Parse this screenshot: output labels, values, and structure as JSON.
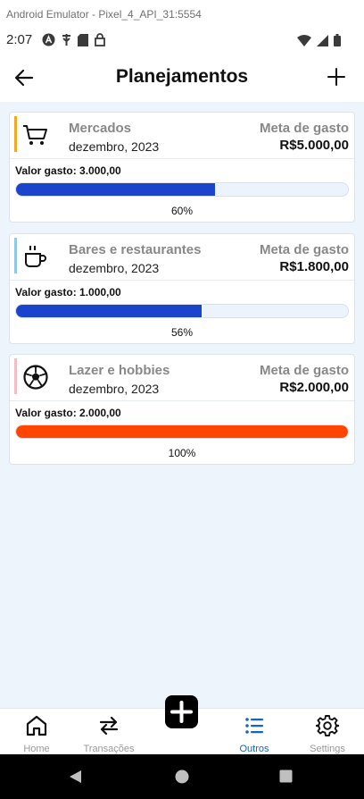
{
  "emulator": {
    "title": "Android Emulator - Pixel_4_API_31:5554"
  },
  "status_bar": {
    "time": "2:07",
    "icons": [
      "notification-a-icon",
      "usb-icon",
      "sd-card-icon",
      "lock-icon",
      "wifi-icon",
      "signal-icon",
      "battery-icon"
    ]
  },
  "app_bar": {
    "title": "Planejamentos",
    "back_icon": "arrow-back-icon",
    "add_icon": "plus-icon"
  },
  "cards": [
    {
      "name": "Mercados",
      "date": "dezembro, 2023",
      "meta_label": "Meta de gasto",
      "meta_value": "R$5.000,00",
      "spent": "Valor gasto: 3.000,00",
      "percent_label": "60%",
      "progress": 0.6,
      "accent_color": "#f5a623",
      "bar_color": "#1a44cc",
      "icon": "shopping-cart-icon"
    },
    {
      "name": "Bares e restaurantes",
      "date": "dezembro, 2023",
      "meta_label": "Meta de gasto",
      "meta_value": "R$1.800,00",
      "spent": "Valor gasto: 1.000,00",
      "percent_label": "56%",
      "progress": 0.56,
      "accent_color": "#8ec9e8",
      "bar_color": "#1a44cc",
      "icon": "coffee-cup-icon"
    },
    {
      "name": "Lazer e hobbies",
      "date": "dezembro, 2023",
      "meta_label": "Meta de gasto",
      "meta_value": "R$2.000,00",
      "spent": "Valor gasto: 2.000,00",
      "percent_label": "100%",
      "progress": 1.0,
      "accent_color": "#f4bcc4",
      "bar_color": "#ff4500",
      "icon": "soccer-ball-icon"
    }
  ],
  "bottom_nav": {
    "items": [
      {
        "label": "Home",
        "icon": "home-icon",
        "active": false
      },
      {
        "label": "Transações",
        "icon": "transfer-arrows-icon",
        "active": false
      },
      {
        "label": "Outros",
        "icon": "list-icon",
        "active": true
      },
      {
        "label": "Settings",
        "icon": "gear-icon",
        "active": false
      }
    ],
    "fab_icon": "plus-icon",
    "active_color": "#1565c0"
  },
  "system_nav": {
    "icons": [
      "back-triangle-icon",
      "home-circle-icon",
      "recents-square-icon"
    ]
  }
}
